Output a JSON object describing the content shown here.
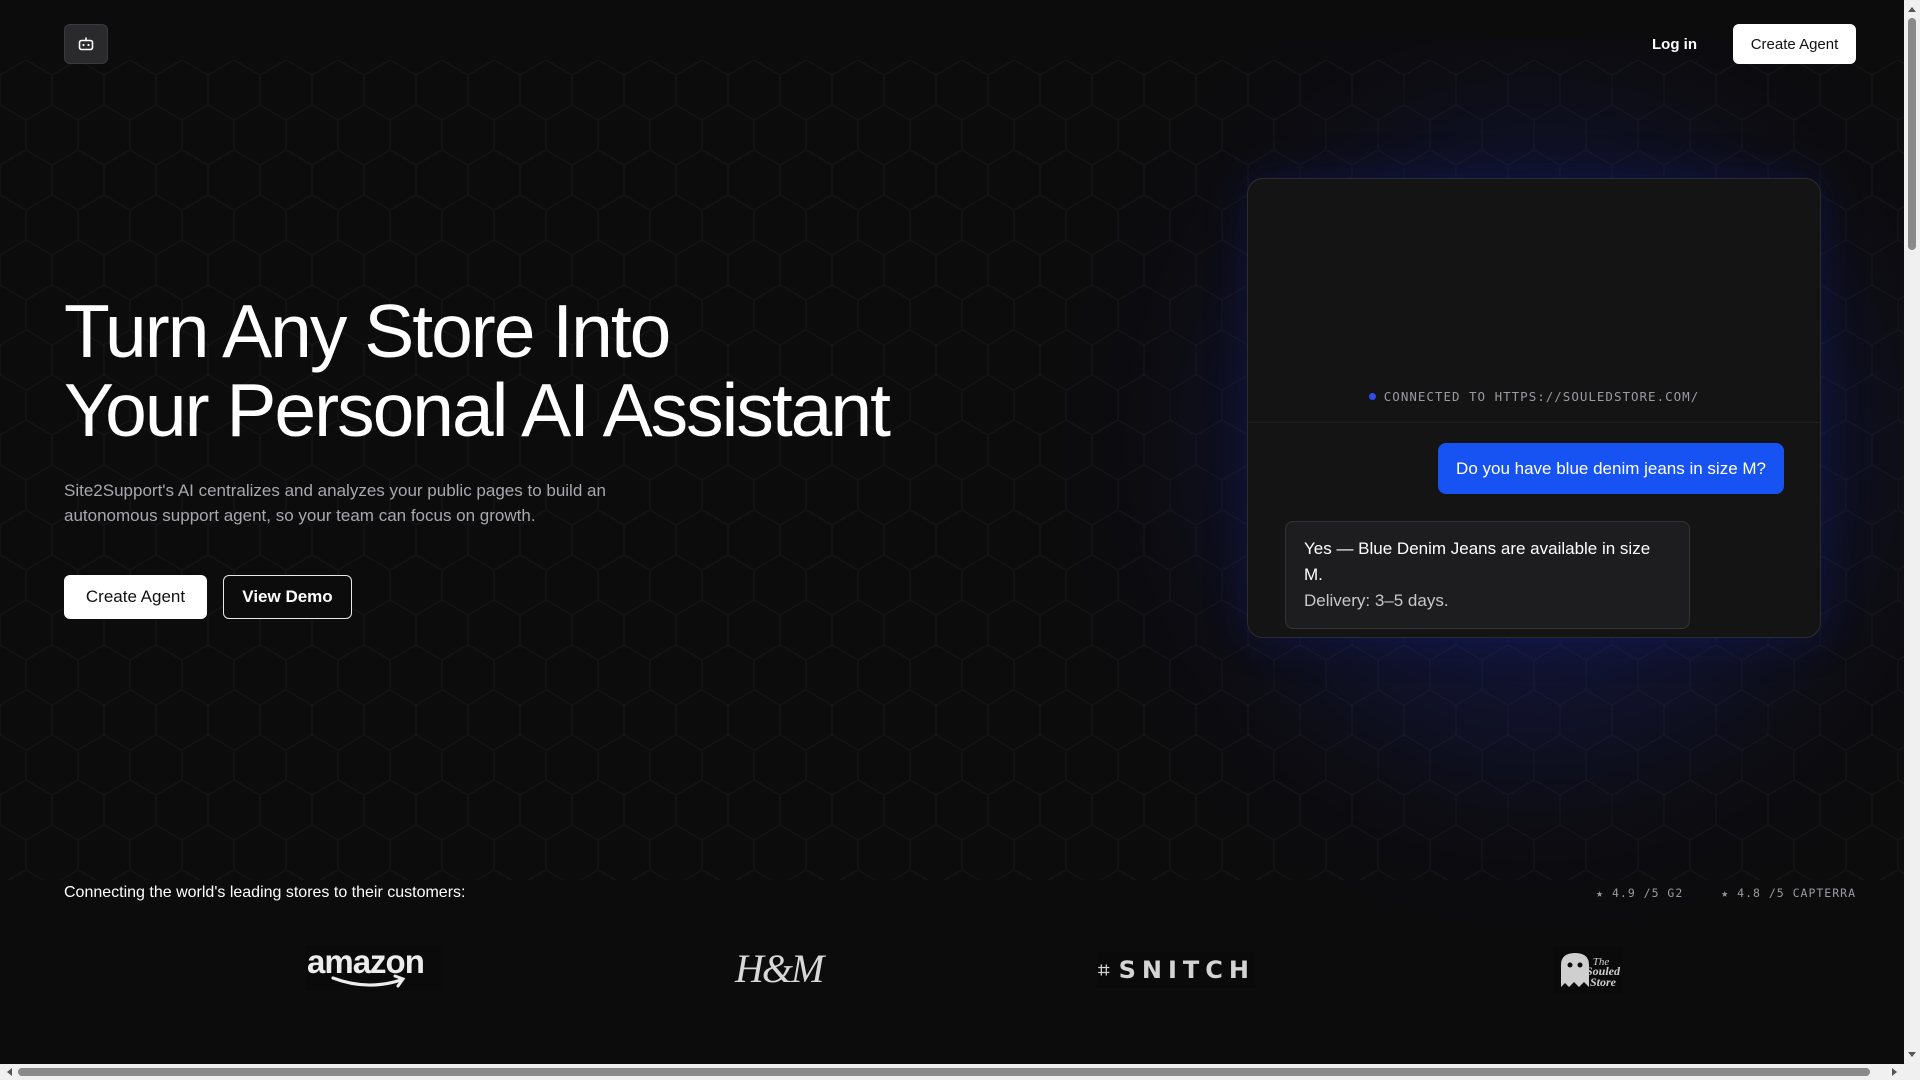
{
  "header": {
    "logo_icon": "bot-icon",
    "login_label": "Log in",
    "create_agent_label": "Create Agent"
  },
  "hero": {
    "title_line1": "Turn Any Store Into",
    "title_line2": "Your Personal AI Assistant",
    "subtitle_line1": "Site2Support's AI centralizes and analyzes your public pages to build an",
    "subtitle_line2": "autonomous support agent, so your team can focus on growth.",
    "primary_button": "Create Agent",
    "secondary_button": "View Demo"
  },
  "chat": {
    "connection_status": "CONNECTED TO HTTPS://SOULEDSTORE.COM/",
    "user_message": "Do you have blue denim jeans in size M?",
    "bot_message_line1": "Yes — Blue Denim Jeans are available in size M.",
    "bot_message_line2": "Delivery: 3–5 days.",
    "accent_color": "#1753f2"
  },
  "stores": {
    "heading": "Connecting the world's leading stores to their customers:",
    "ratings": [
      {
        "label": "★ 4.9 /5 G2"
      },
      {
        "label": "★ 4.8 /5 CAPTERRA"
      }
    ],
    "logos": [
      {
        "name": "amazon"
      },
      {
        "name": "H&M"
      },
      {
        "name": "SNITCH"
      },
      {
        "name": "The Souled Store"
      }
    ]
  }
}
